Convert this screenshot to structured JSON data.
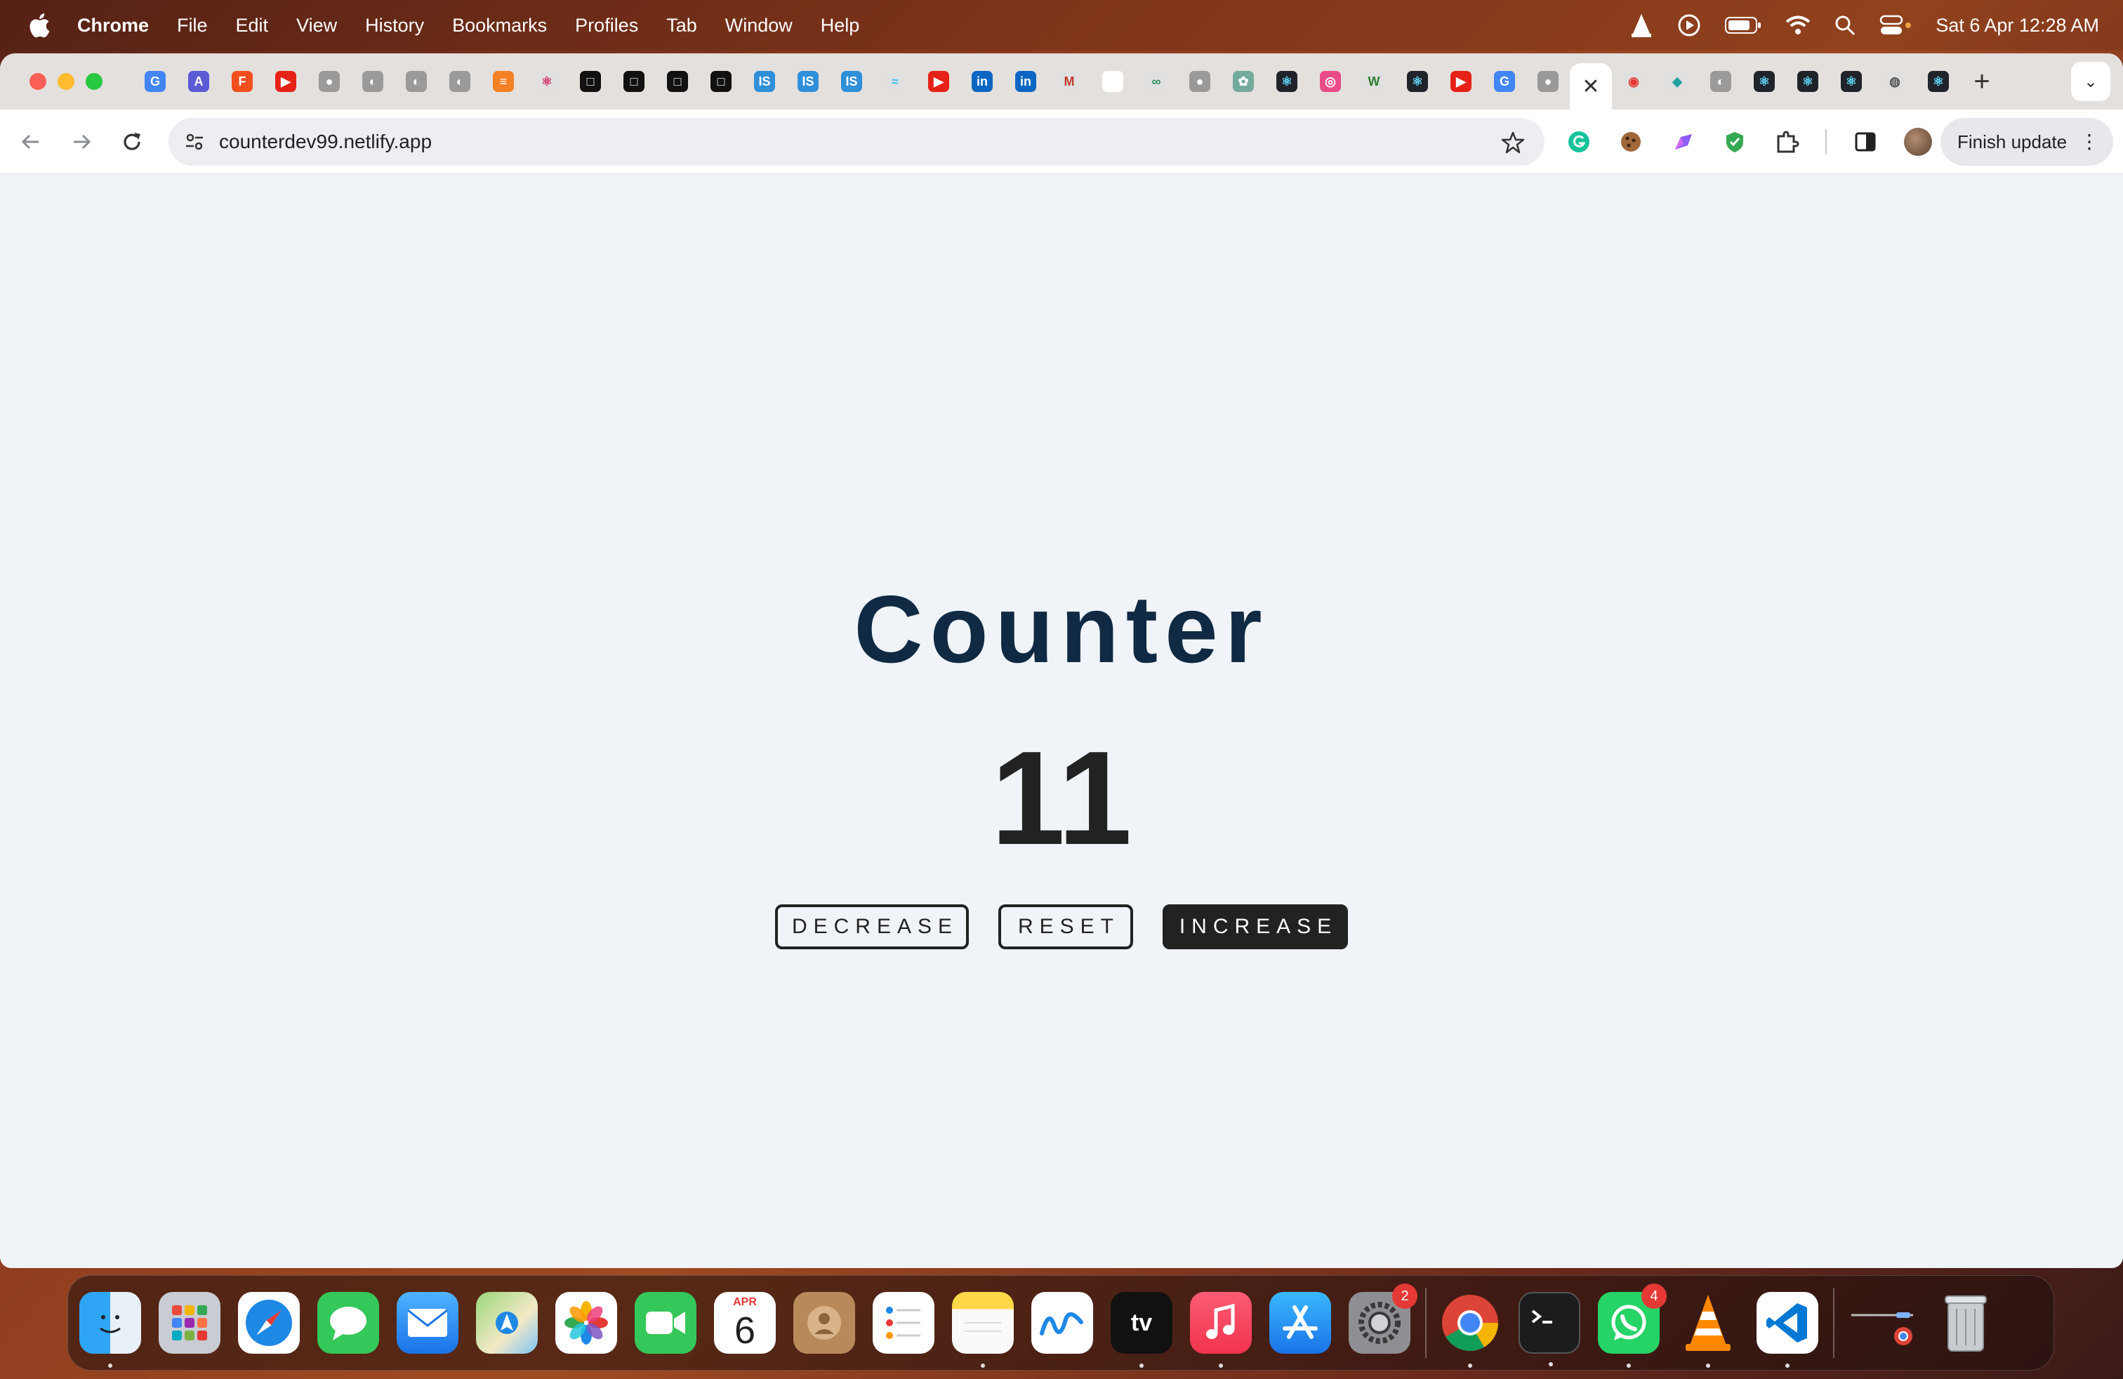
{
  "menubar": {
    "app_name": "Chrome",
    "items": [
      "File",
      "Edit",
      "View",
      "History",
      "Bookmarks",
      "Profiles",
      "Tab",
      "Window",
      "Help"
    ],
    "clock": "Sat 6 Apr  12:28 AM"
  },
  "browser": {
    "active_tab_close": "✕",
    "new_tab": "+",
    "tab_search": "⌄",
    "url": "counterdev99.netlify.app",
    "finish_update_label": "Finish update",
    "menu_dots": "⋮"
  },
  "tab_favicons": [
    {
      "name": "google-tab-icon",
      "glyph": "G",
      "color": "#4285f4",
      "fg": "#fff"
    },
    {
      "name": "arc-tab-icon",
      "glyph": "A",
      "color": "#5b5bd6",
      "fg": "#fff"
    },
    {
      "name": "figma-tab-icon",
      "glyph": "F",
      "color": "#f24e1e",
      "fg": "#fff"
    },
    {
      "name": "youtube-tab-icon",
      "glyph": "▶",
      "color": "#e62117",
      "fg": "#fff"
    },
    {
      "name": "github-tab-icon",
      "glyph": "●",
      "color": "#9a9a9a",
      "fg": "#fff"
    },
    {
      "name": "globe-tab-icon",
      "glyph": "◐",
      "color": "#9a9a9a",
      "fg": "#fff"
    },
    {
      "name": "globe-tab-icon",
      "glyph": "◐",
      "color": "#9a9a9a",
      "fg": "#fff"
    },
    {
      "name": "globe-tab-icon",
      "glyph": "◐",
      "color": "#9a9a9a",
      "fg": "#fff"
    },
    {
      "name": "stackoverflow-tab-icon",
      "glyph": "≡",
      "color": "#f48024",
      "fg": "#fff"
    },
    {
      "name": "react-tab-icon",
      "glyph": "⚛",
      "color": "#e0e0e0",
      "fg": "#d6336c"
    },
    {
      "name": "square-tab-icon",
      "glyph": "□",
      "color": "#111111",
      "fg": "#fff"
    },
    {
      "name": "square-tab-icon",
      "glyph": "□",
      "color": "#111111",
      "fg": "#fff"
    },
    {
      "name": "square-tab-icon",
      "glyph": "□",
      "color": "#111111",
      "fg": "#fff"
    },
    {
      "name": "square-tab-icon",
      "glyph": "□",
      "color": "#111111",
      "fg": "#fff"
    },
    {
      "name": "is-tab-icon",
      "glyph": "IS",
      "color": "#2f8fd8",
      "fg": "#fff"
    },
    {
      "name": "is-tab-icon",
      "glyph": "IS",
      "color": "#2f8fd8",
      "fg": "#fff"
    },
    {
      "name": "is-tab-icon",
      "glyph": "IS",
      "color": "#2f8fd8",
      "fg": "#fff"
    },
    {
      "name": "tailwind-tab-icon",
      "glyph": "≈",
      "color": "#e0e0e0",
      "fg": "#38bdf8"
    },
    {
      "name": "youtube-tab-icon",
      "glyph": "▶",
      "color": "#e62117",
      "fg": "#fff"
    },
    {
      "name": "linkedin-tab-icon",
      "glyph": "in",
      "color": "#0a66c2",
      "fg": "#fff"
    },
    {
      "name": "linkedin-tab-icon",
      "glyph": "in",
      "color": "#0a66c2",
      "fg": "#fff"
    },
    {
      "name": "medium-tab-icon",
      "glyph": "M",
      "color": "#e0e0e0",
      "fg": "#c0392b"
    },
    {
      "name": "blank-tab-icon",
      "glyph": "",
      "color": "#ffffff",
      "fg": "#fff"
    },
    {
      "name": "infinity-tab-icon",
      "glyph": "∞",
      "color": "#e0e0e0",
      "fg": "#2e8b57"
    },
    {
      "name": "github-tab-icon",
      "glyph": "●",
      "color": "#9a9a9a",
      "fg": "#fff"
    },
    {
      "name": "openai-tab-icon",
      "glyph": "✿",
      "color": "#74aa9c",
      "fg": "#fff"
    },
    {
      "name": "react-tab-icon",
      "glyph": "⚛",
      "color": "#20232a",
      "fg": "#61dafb"
    },
    {
      "name": "dribbble-tab-icon",
      "glyph": "◎",
      "color": "#ea4c89",
      "fg": "#fff"
    },
    {
      "name": "w-tab-icon",
      "glyph": "W",
      "color": "#e0e0e0",
      "fg": "#2e7d32"
    },
    {
      "name": "react-tab-icon",
      "glyph": "⚛",
      "color": "#20232a",
      "fg": "#61dafb"
    },
    {
      "name": "youtube-tab-icon",
      "glyph": "▶",
      "color": "#e62117",
      "fg": "#fff"
    },
    {
      "name": "google-tab-icon",
      "glyph": "G",
      "color": "#4285f4",
      "fg": "#fff"
    },
    {
      "name": "github-tab-icon",
      "glyph": "●",
      "color": "#9a9a9a",
      "fg": "#fff"
    }
  ],
  "tab_favicons_after": [
    {
      "name": "target-tab-icon",
      "glyph": "◉",
      "color": "#e0e0e0",
      "fg": "#e53935"
    },
    {
      "name": "diamond-tab-icon",
      "glyph": "◆",
      "color": "#e0e0e0",
      "fg": "#20a39e"
    },
    {
      "name": "globe-tab-icon",
      "glyph": "◐",
      "color": "#9a9a9a",
      "fg": "#fff"
    },
    {
      "name": "react-tab-icon",
      "glyph": "⚛",
      "color": "#20232a",
      "fg": "#61dafb"
    },
    {
      "name": "react-tab-icon",
      "glyph": "⚛",
      "color": "#20232a",
      "fg": "#61dafb"
    },
    {
      "name": "react-tab-icon",
      "glyph": "⚛",
      "color": "#20232a",
      "fg": "#61dafb"
    },
    {
      "name": "chrome-tab-icon",
      "glyph": "◍",
      "color": "#e0e0e0",
      "fg": "#555"
    },
    {
      "name": "react-tab-icon",
      "glyph": "⚛",
      "color": "#20232a",
      "fg": "#61dafb"
    }
  ],
  "page": {
    "title": "Counter",
    "count": "11",
    "decrease_label": "DECREASE",
    "reset_label": "RESET",
    "increase_label": "INCREASE"
  },
  "dock": {
    "calendar_month": "APR",
    "calendar_day": "6",
    "settings_badge": "2",
    "whatsapp_badge": "4"
  },
  "colors": {
    "title": "#102a43",
    "count": "#222222",
    "page_background": "#f0f4f8",
    "increase_button_bg": "#222222"
  }
}
